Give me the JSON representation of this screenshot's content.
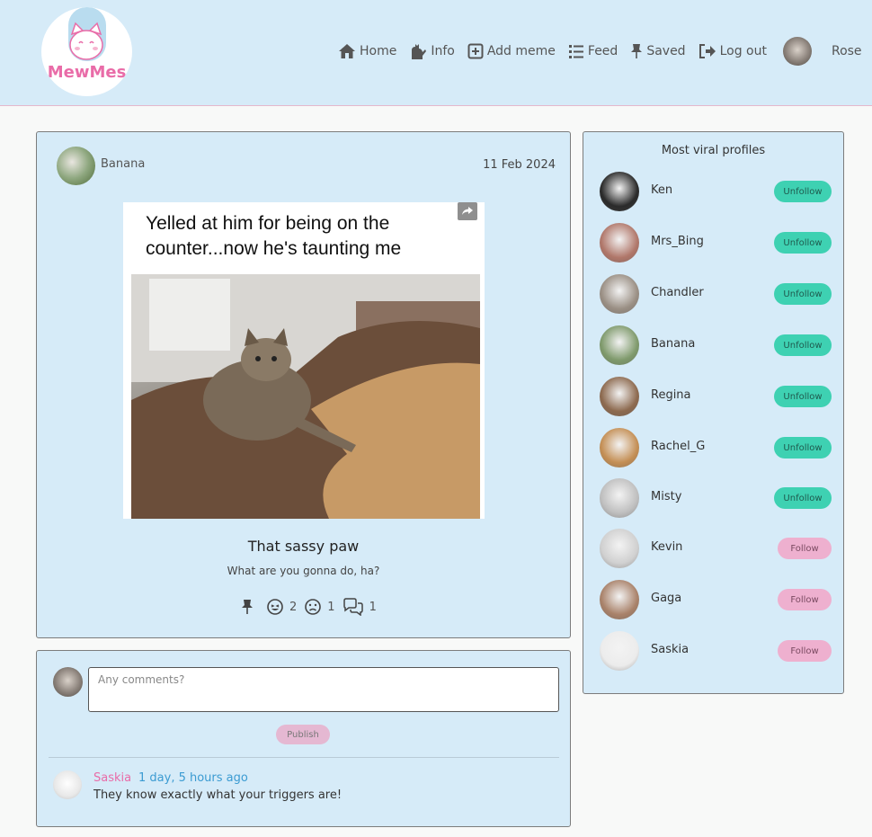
{
  "app": {
    "logo_text": "MewMes"
  },
  "nav": {
    "items": [
      {
        "label": "Home",
        "icon": "home-icon"
      },
      {
        "label": "Info",
        "icon": "cat-icon"
      },
      {
        "label": "Add meme",
        "icon": "plus-square-icon"
      },
      {
        "label": "Feed",
        "icon": "list-icon"
      },
      {
        "label": "Saved",
        "icon": "pin-icon"
      },
      {
        "label": "Log out",
        "icon": "logout-icon"
      }
    ],
    "user_name": "Rose"
  },
  "post": {
    "author": "Banana",
    "date": "11 Feb 2024",
    "meme_text": "Yelled at him for being on the counter...now he's taunting me",
    "title": "That sassy paw",
    "caption": "What are you gonna do, ha?",
    "laugh_count": "2",
    "sad_count": "1",
    "comment_count": "1"
  },
  "comments": {
    "placeholder": "Any comments?",
    "publish_label": "Publish",
    "items": [
      {
        "author": "Saskia",
        "time": "1 day, 5 hours ago",
        "text": "They know exactly what your triggers are!"
      }
    ]
  },
  "viral": {
    "title": "Most viral profiles",
    "profiles": [
      {
        "name": "Ken",
        "action": "Unfollow",
        "color": "#2a2a2a"
      },
      {
        "name": "Mrs_Bing",
        "action": "Unfollow",
        "color": "#b0776a"
      },
      {
        "name": "Chandler",
        "action": "Unfollow",
        "color": "#9a8f84"
      },
      {
        "name": "Banana",
        "action": "Unfollow",
        "color": "#7f9a6c"
      },
      {
        "name": "Regina",
        "action": "Unfollow",
        "color": "#8d6a4f"
      },
      {
        "name": "Rachel_G",
        "action": "Unfollow",
        "color": "#c48f55"
      },
      {
        "name": "Misty",
        "action": "Unfollow",
        "color": "#bfbfbf"
      },
      {
        "name": "Kevin",
        "action": "Follow",
        "color": "#d0d0d0"
      },
      {
        "name": "Gaga",
        "action": "Follow",
        "color": "#a9826a"
      },
      {
        "name": "Saskia",
        "action": "Follow",
        "color": "#ececec"
      }
    ]
  },
  "colors": {
    "header_bg": "#d6ebf8",
    "accent_pink": "#e96ca8",
    "unfollow_green": "#3ed1b2",
    "follow_pink": "#eeb0cf"
  }
}
